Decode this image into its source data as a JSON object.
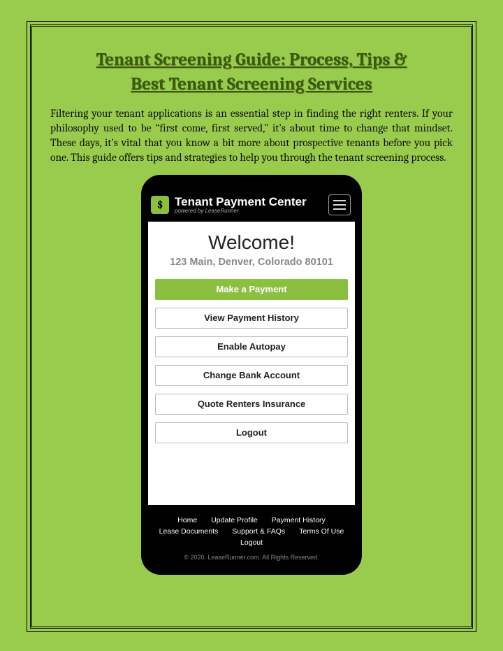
{
  "title_line1": "Tenant Screening Guide: Process, Tips &",
  "title_line2": "Best Tenant Screening Services",
  "body": "Filtering your tenant applications is an essential step in finding the right renters. If your philosophy used to be “first come, first served,” it’s about time to change that mindset. These days, it’s vital that you know a bit more about prospective tenants before you pick one. This guide offers tips and strategies to help you through the tenant screening process.",
  "app": {
    "logo_glyph": "$",
    "header_title": "Tenant Payment Center",
    "header_sub": "powered by LeaseRunner",
    "welcome": "Welcome!",
    "address": "123 Main, Denver, Colorado 80101",
    "buttons": {
      "primary": "Make a Payment",
      "b1": "View Payment History",
      "b2": "Enable Autopay",
      "b3": "Change Bank Account",
      "b4": "Quote Renters Insurance",
      "b5": "Logout"
    },
    "footer": {
      "l0": "Home",
      "l1": "Update Profile",
      "l2": "Payment History",
      "l3": "Lease Documents",
      "l4": "Support & FAQs",
      "l5": "Terms Of Use",
      "l6": "Logout"
    },
    "copyright": "© 2020. LeaseRunner.com. All Rights Reserved."
  }
}
